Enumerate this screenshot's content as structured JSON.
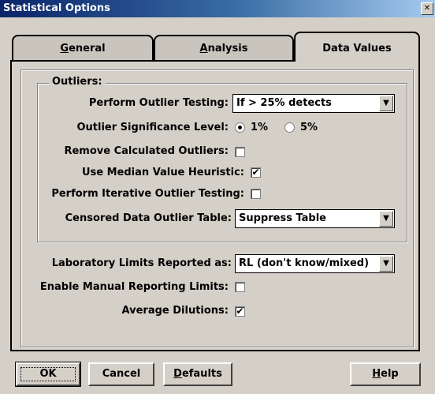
{
  "window": {
    "title": "Statistical Options"
  },
  "tabs": [
    {
      "label": "General",
      "accel": "G",
      "rest": "eneral"
    },
    {
      "label": "Analysis",
      "accel": "A",
      "rest": "nalysis"
    },
    {
      "label": "Data Values"
    }
  ],
  "outliers": {
    "group_label": "Outliers:",
    "testing_label": "Perform Outlier Testing:",
    "testing_value": "If > 25% detects",
    "significance_label": "Outlier Significance Level:",
    "significance_options": [
      "1%",
      "5%"
    ],
    "significance_selected": "1%",
    "remove_label": "Remove Calculated Outliers:",
    "remove_checked": false,
    "median_label": "Use Median Value Heuristic:",
    "median_checked": true,
    "iterative_label": "Perform Iterative Outlier Testing:",
    "iterative_checked": false,
    "censored_label": "Censored Data Outlier Table:",
    "censored_value": "Suppress Table"
  },
  "limits": {
    "reported_label": "Laboratory Limits Reported as:",
    "reported_value": "RL (don't know/mixed)",
    "manual_label": "Enable Manual Reporting Limits:",
    "manual_checked": false,
    "dilutions_label": "Average Dilutions:",
    "dilutions_checked": true
  },
  "buttons": {
    "ok": "OK",
    "cancel": "Cancel",
    "defaults_accel": "D",
    "defaults_rest": "efaults",
    "help_accel": "H",
    "help_rest": "elp"
  }
}
